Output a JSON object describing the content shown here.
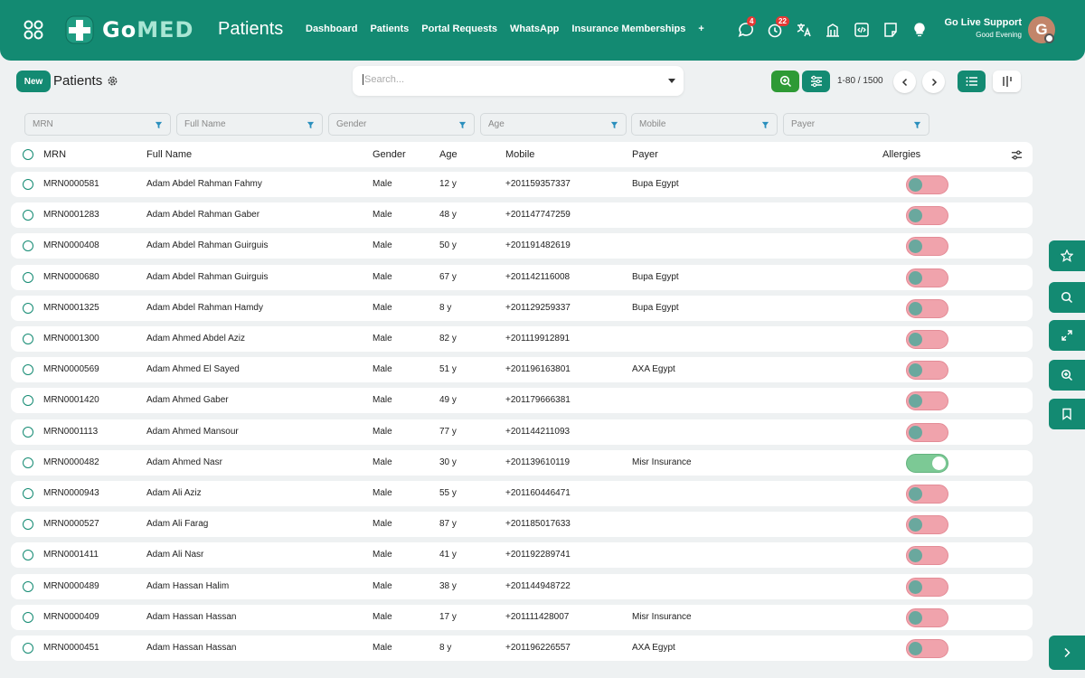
{
  "app": {
    "logo_text_a": "Go",
    "logo_text_b": "MED",
    "page_title": "Patients"
  },
  "nav": [
    "Dashboard",
    "Patients",
    "Portal Requests",
    "WhatsApp",
    "Insurance Memberships",
    "+"
  ],
  "topbar": {
    "messages_badge": "4",
    "reminders_badge": "22",
    "support_title": "Go Live Support",
    "greeting": "Good Evening",
    "avatar_letter": "G"
  },
  "toolbar": {
    "new_label": "New",
    "list_title": "Patients",
    "search_placeholder": "Search...",
    "pager": "1-80 / 1500"
  },
  "filters": [
    "MRN",
    "Full Name",
    "Gender",
    "Age",
    "Mobile",
    "Payer"
  ],
  "columns": {
    "mrn": "MRN",
    "name": "Full Name",
    "gender": "Gender",
    "age": "Age",
    "mobile": "Mobile",
    "payer": "Payer",
    "allergies": "Allergies"
  },
  "rows": [
    {
      "mrn": "MRN0000581",
      "name": "Adam Abdel Rahman Fahmy",
      "gender": "Male",
      "age": "12 y",
      "mobile": "+201159357337",
      "payer": "Bupa Egypt",
      "allergy": false
    },
    {
      "mrn": "MRN0001283",
      "name": "Adam Abdel Rahman Gaber",
      "gender": "Male",
      "age": "48 y",
      "mobile": "+201147747259",
      "payer": "",
      "allergy": false
    },
    {
      "mrn": "MRN0000408",
      "name": "Adam Abdel Rahman Guirguis",
      "gender": "Male",
      "age": "50 y",
      "mobile": "+201191482619",
      "payer": "",
      "allergy": false
    },
    {
      "mrn": "MRN0000680",
      "name": "Adam Abdel Rahman Guirguis",
      "gender": "Male",
      "age": "67 y",
      "mobile": "+201142116008",
      "payer": "Bupa Egypt",
      "allergy": false
    },
    {
      "mrn": "MRN0001325",
      "name": "Adam Abdel Rahman Hamdy",
      "gender": "Male",
      "age": "8 y",
      "mobile": "+201129259337",
      "payer": "Bupa Egypt",
      "allergy": false
    },
    {
      "mrn": "MRN0001300",
      "name": "Adam Ahmed Abdel Aziz",
      "gender": "Male",
      "age": "82 y",
      "mobile": "+201119912891",
      "payer": "",
      "allergy": false
    },
    {
      "mrn": "MRN0000569",
      "name": "Adam Ahmed El Sayed",
      "gender": "Male",
      "age": "51 y",
      "mobile": "+201196163801",
      "payer": "AXA Egypt",
      "allergy": false
    },
    {
      "mrn": "MRN0001420",
      "name": "Adam Ahmed Gaber",
      "gender": "Male",
      "age": "49 y",
      "mobile": "+201179666381",
      "payer": "",
      "allergy": false
    },
    {
      "mrn": "MRN0001113",
      "name": "Adam Ahmed Mansour",
      "gender": "Male",
      "age": "77 y",
      "mobile": "+201144211093",
      "payer": "",
      "allergy": false
    },
    {
      "mrn": "MRN0000482",
      "name": "Adam Ahmed Nasr",
      "gender": "Male",
      "age": "30 y",
      "mobile": "+201139610119",
      "payer": "Misr Insurance",
      "allergy": true
    },
    {
      "mrn": "MRN0000943",
      "name": "Adam Ali Aziz",
      "gender": "Male",
      "age": "55 y",
      "mobile": "+201160446471",
      "payer": "",
      "allergy": false
    },
    {
      "mrn": "MRN0000527",
      "name": "Adam Ali Farag",
      "gender": "Male",
      "age": "87 y",
      "mobile": "+201185017633",
      "payer": "",
      "allergy": false
    },
    {
      "mrn": "MRN0001411",
      "name": "Adam Ali Nasr",
      "gender": "Male",
      "age": "41 y",
      "mobile": "+201192289741",
      "payer": "",
      "allergy": false
    },
    {
      "mrn": "MRN0000489",
      "name": "Adam Hassan Halim",
      "gender": "Male",
      "age": "38 y",
      "mobile": "+201144948722",
      "payer": "",
      "allergy": false
    },
    {
      "mrn": "MRN0000409",
      "name": "Adam Hassan Hassan",
      "gender": "Male",
      "age": "17 y",
      "mobile": "+201111428007",
      "payer": "Misr Insurance",
      "allergy": false
    },
    {
      "mrn": "MRN0000451",
      "name": "Adam Hassan Hassan",
      "gender": "Male",
      "age": "8 y",
      "mobile": "+201196226557",
      "payer": "AXA Egypt",
      "allergy": false
    }
  ],
  "icons": {
    "apps": "apps-grid-icon",
    "side": [
      "star-icon",
      "search-icon",
      "expand-icon",
      "zoom-in-icon",
      "bookmark-icon",
      "chevron-right-icon"
    ]
  },
  "colors": {
    "brand": "#138a72",
    "zoom_button": "#2e9a35",
    "toggle_off": "#f0a3ac",
    "toggle_on": "#7cc995",
    "badge": "#e53935"
  }
}
